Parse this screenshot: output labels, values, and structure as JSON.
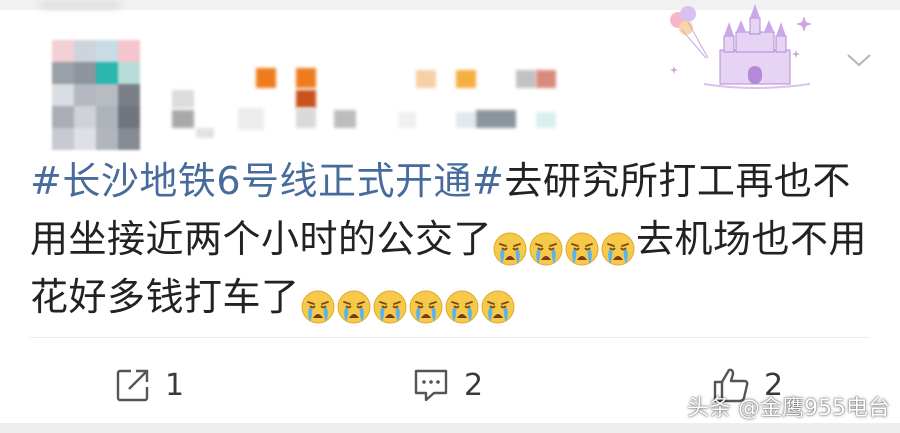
{
  "post": {
    "topic": "#长沙地铁6号线正式开通#",
    "text_part1": "去研究所打工再也不用坐接近两个小时的公交了",
    "crying_emoji_group1": 4,
    "text_part2": "去机场也不用花好多钱打车了",
    "crying_emoji_group2": 6
  },
  "actions": {
    "repost_count": "1",
    "comment_count": "2",
    "like_count": "2"
  },
  "icons": {
    "repost": "share-arrow-icon",
    "comment": "comment-bubble-icon",
    "like": "thumbs-up-icon",
    "more": "chevron-down-icon",
    "emoji": "crying-face-emoji",
    "decoration": "castle-balloons-sticker"
  },
  "watermark": "头条 @金鹰955电台",
  "colors": {
    "topic_link": "#476b9c",
    "text": "#222222",
    "icon": "#555555"
  }
}
